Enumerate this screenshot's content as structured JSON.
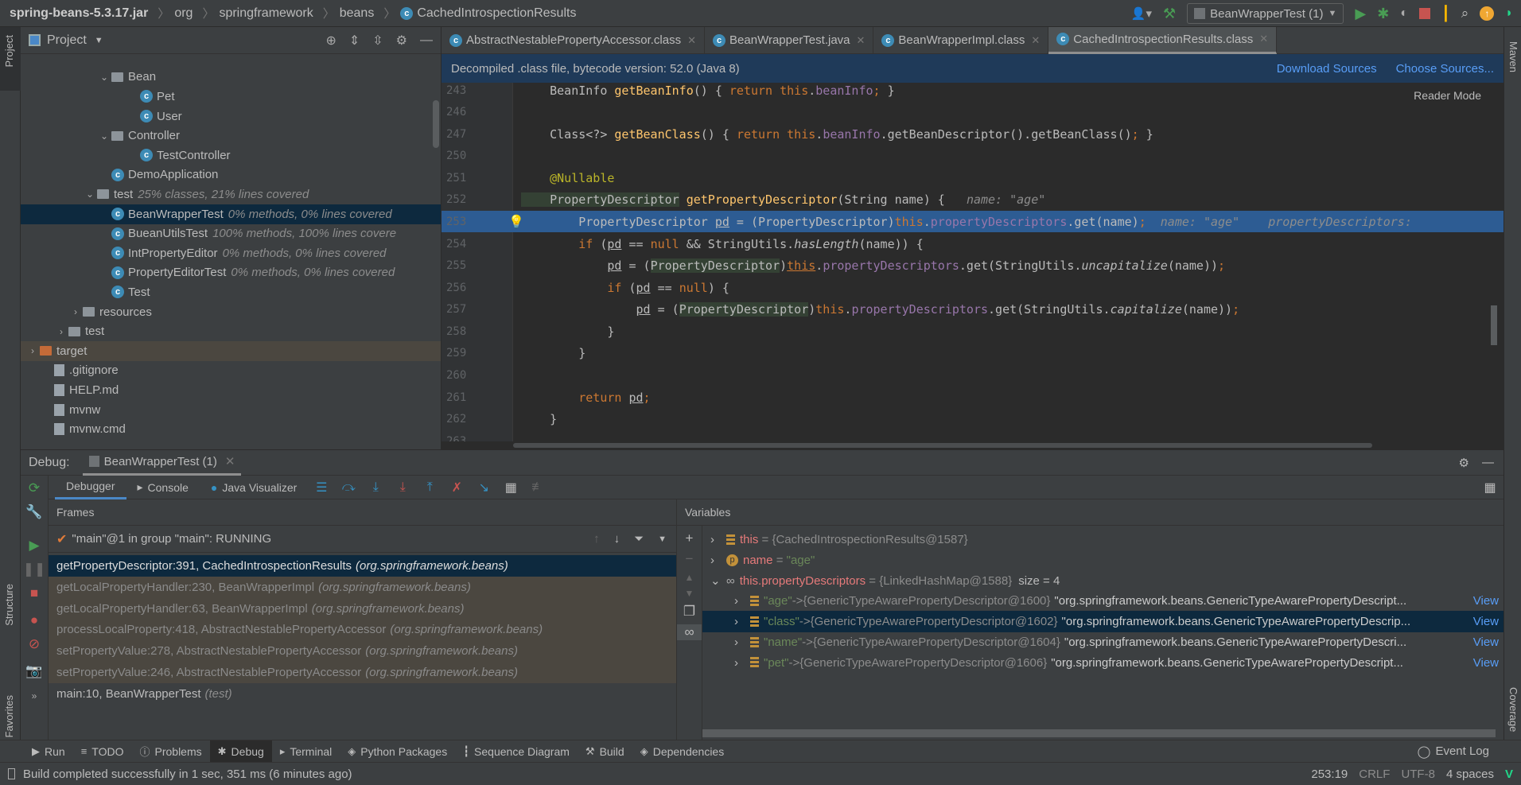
{
  "breadcrumb": [
    "spring-beans-5.3.17.jar",
    "org",
    "springframework",
    "beans",
    "CachedIntrospectionResults"
  ],
  "toolbar": {
    "run_config": "BeanWrapperTest (1)"
  },
  "colors": {
    "accent": "#4a88c7",
    "selection": "#2d5c93",
    "link": "#589df6",
    "run": "#499c54",
    "stop": "#c75450"
  },
  "left_strip": {
    "project": "Project",
    "structure": "Structure",
    "favorites": "Favorites"
  },
  "right_strip": {
    "maven": "Maven",
    "coverage": "Coverage"
  },
  "project": {
    "title": "Project",
    "tree": [
      {
        "label": "Bean",
        "type": "folder",
        "expanded": true,
        "indent": 1
      },
      {
        "label": "Pet",
        "type": "class",
        "indent": 2
      },
      {
        "label": "User",
        "type": "class",
        "indent": 2
      },
      {
        "label": "Controller",
        "type": "folder",
        "expanded": true,
        "indent": 1
      },
      {
        "label": "TestController",
        "type": "class",
        "indent": 2
      },
      {
        "label": "DemoApplication",
        "type": "class",
        "indent": 1
      },
      {
        "label": "test",
        "hint": "25% classes, 21% lines covered",
        "type": "folder",
        "expanded": true,
        "indent": 0.5
      },
      {
        "label": "BeanWrapperTest",
        "hint": "0% methods, 0% lines covered",
        "type": "class",
        "indent": 1,
        "selected": true
      },
      {
        "label": "BueanUtilsTest",
        "hint": "100% methods, 100% lines covere",
        "type": "class",
        "indent": 1
      },
      {
        "label": "IntPropertyEditor",
        "hint": "0% methods, 0% lines covered",
        "type": "class",
        "indent": 1
      },
      {
        "label": "PropertyEditorTest",
        "hint": "0% methods, 0% lines covered",
        "type": "class",
        "indent": 1
      },
      {
        "label": "Test",
        "type": "class",
        "indent": 1
      },
      {
        "label": "resources",
        "type": "folder",
        "expanded": false,
        "indent": 0
      },
      {
        "label": "test",
        "type": "folder",
        "expanded": false,
        "indent": -0.5
      },
      {
        "label": "target",
        "type": "folder-orange",
        "expanded": false,
        "indent": -1.5,
        "highlight": true
      },
      {
        "label": ".gitignore",
        "type": "file",
        "indent": -1
      },
      {
        "label": "HELP.md",
        "type": "file",
        "indent": -1
      },
      {
        "label": "mvnw",
        "type": "file",
        "indent": -1
      },
      {
        "label": "mvnw.cmd",
        "type": "file",
        "indent": -1
      }
    ]
  },
  "editor": {
    "tabs": [
      {
        "label": "AbstractNestablePropertyAccessor.class"
      },
      {
        "label": "BeanWrapperTest.java"
      },
      {
        "label": "BeanWrapperImpl.class"
      },
      {
        "label": "CachedIntrospectionResults.class",
        "active": true
      }
    ],
    "notice": "Decompiled .class file, bytecode version: 52.0 (Java 8)",
    "download_sources": "Download Sources",
    "choose_sources": "Choose Sources...",
    "reader_mode": "Reader Mode",
    "lines": [
      {
        "n": "243",
        "t": [
          [
            "",
            "    BeanInfo "
          ],
          [
            "fn",
            "getBeanInfo"
          ],
          [
            "",
            "() { "
          ],
          [
            "kw",
            "return this"
          ],
          [
            "",
            "."
          ],
          [
            "fld",
            "beanInfo"
          ],
          [
            "kw",
            ";"
          ],
          [
            "",
            " }"
          ]
        ]
      },
      {
        "n": "246",
        "t": []
      },
      {
        "n": "247",
        "t": [
          [
            "",
            "    Class<?> "
          ],
          [
            "fn",
            "getBeanClass"
          ],
          [
            "",
            "() { "
          ],
          [
            "kw",
            "return this"
          ],
          [
            "",
            "."
          ],
          [
            "fld",
            "beanInfo"
          ],
          [
            "",
            ".getBeanDescriptor().getBeanClass()"
          ],
          [
            "kw",
            ";"
          ],
          [
            "",
            " }"
          ]
        ]
      },
      {
        "n": "250",
        "t": []
      },
      {
        "n": "251",
        "t": [
          [
            "ann",
            "    @Nullable"
          ]
        ]
      },
      {
        "n": "252",
        "t": [
          [
            "",
            ""
          ],
          [
            "typ",
            "    PropertyDescriptor"
          ],
          [
            "",
            " "
          ],
          [
            "fn",
            "getPropertyDescriptor"
          ],
          [
            "",
            "(String name) {   "
          ],
          [
            "hint",
            "name: \"age\""
          ]
        ]
      },
      {
        "n": "253",
        "hl": true,
        "t": [
          [
            "",
            "        PropertyDescriptor "
          ],
          [
            "ul",
            "pd"
          ],
          [
            "",
            " = (PropertyDescriptor)"
          ],
          [
            "kw",
            "this"
          ],
          [
            "",
            "."
          ],
          [
            "fld",
            "propertyDescriptors"
          ],
          [
            "",
            ".get(name)"
          ],
          [
            "kw",
            ";"
          ],
          [
            "",
            "  "
          ],
          [
            "hint",
            "name: \"age\"    propertyDescriptors: "
          ]
        ]
      },
      {
        "n": "254",
        "t": [
          [
            "kw",
            "        if"
          ],
          [
            "",
            " ("
          ],
          [
            "ul",
            "pd"
          ],
          [
            "",
            " == "
          ],
          [
            "kw",
            "null"
          ],
          [
            "",
            " && StringUtils."
          ],
          [
            "it",
            "hasLength"
          ],
          [
            "",
            "(name)) {"
          ]
        ]
      },
      {
        "n": "255",
        "t": [
          [
            "",
            "            "
          ],
          [
            "ul",
            "pd"
          ],
          [
            "",
            " = ("
          ],
          [
            "typ",
            "PropertyDescriptor"
          ],
          [
            "",
            ")"
          ],
          [
            "kw ul",
            "this"
          ],
          [
            "",
            "."
          ],
          [
            "fld",
            "propertyDescriptors"
          ],
          [
            "",
            ".get(StringUtils."
          ],
          [
            "it",
            "uncapitalize"
          ],
          [
            "",
            "(name))"
          ],
          [
            "kw",
            ";"
          ]
        ]
      },
      {
        "n": "256",
        "t": [
          [
            "kw",
            "            if"
          ],
          [
            "",
            " ("
          ],
          [
            "ul",
            "pd"
          ],
          [
            "",
            " == "
          ],
          [
            "kw",
            "null"
          ],
          [
            "",
            ") {"
          ]
        ]
      },
      {
        "n": "257",
        "t": [
          [
            "",
            "                "
          ],
          [
            "ul",
            "pd"
          ],
          [
            "",
            " = ("
          ],
          [
            "typ",
            "PropertyDescriptor"
          ],
          [
            "",
            ")"
          ],
          [
            "kw",
            "this"
          ],
          [
            "",
            "."
          ],
          [
            "fld",
            "propertyDescriptors"
          ],
          [
            "",
            ".get(StringUtils."
          ],
          [
            "it",
            "capitalize"
          ],
          [
            "",
            "(name))"
          ],
          [
            "kw",
            ";"
          ]
        ]
      },
      {
        "n": "258",
        "t": [
          [
            "",
            "            }"
          ]
        ]
      },
      {
        "n": "259",
        "t": [
          [
            "",
            "        }"
          ]
        ]
      },
      {
        "n": "260",
        "t": []
      },
      {
        "n": "261",
        "t": [
          [
            "kw",
            "        return "
          ],
          [
            "ul",
            "pd"
          ],
          [
            "kw",
            ";"
          ]
        ]
      },
      {
        "n": "262",
        "t": [
          [
            "",
            "    }"
          ]
        ]
      },
      {
        "n": "263",
        "t": []
      }
    ]
  },
  "debug": {
    "label": "Debug:",
    "session": "BeanWrapperTest (1)",
    "tabs": [
      "Debugger",
      "Console",
      "Java Visualizer"
    ],
    "frames_title": "Frames",
    "variables_title": "Variables",
    "thread": "\"main\"@1 in group \"main\": RUNNING",
    "frames": [
      {
        "method": "getPropertyDescriptor:391, CachedIntrospectionResults",
        "pkg": "(org.springframework.beans)",
        "state": "selected"
      },
      {
        "method": "getLocalPropertyHandler:230, BeanWrapperImpl",
        "pkg": "(org.springframework.beans)",
        "state": "library"
      },
      {
        "method": "getLocalPropertyHandler:63, BeanWrapperImpl",
        "pkg": "(org.springframework.beans)",
        "state": "library"
      },
      {
        "method": "processLocalProperty:418, AbstractNestablePropertyAccessor",
        "pkg": "(org.springframework.beans)",
        "state": "library"
      },
      {
        "method": "setPropertyValue:278, AbstractNestablePropertyAccessor",
        "pkg": "(org.springframework.beans)",
        "state": "library"
      },
      {
        "method": "setPropertyValue:246, AbstractNestablePropertyAccessor",
        "pkg": "(org.springframework.beans)",
        "state": "library"
      },
      {
        "method": "main:10, BeanWrapperTest",
        "pkg": "(test)",
        "state": "normal"
      }
    ],
    "variables": [
      {
        "name": "this",
        "eq": " = ",
        "value": "{CachedIntrospectionResults@1587}",
        "icon": "field",
        "expanded": false
      },
      {
        "name": "name",
        "eq": " = ",
        "value": "\"age\"",
        "icon": "param",
        "expanded": false
      },
      {
        "name": "this.propertyDescriptors",
        "eq": " = ",
        "value": "{LinkedHashMap@1588}",
        "extra": "size = 4",
        "icon": "watch",
        "expanded": true
      },
      {
        "key": "\"age\"",
        "arrow": " -> ",
        "value": "{GenericTypeAwarePropertyDescriptor@1600}",
        "str": "\"org.springframework.beans.GenericTypeAwarePropertyDescript...",
        "view": "View",
        "child": true
      },
      {
        "key": "\"class\"",
        "arrow": " -> ",
        "value": "{GenericTypeAwarePropertyDescriptor@1602}",
        "str": "\"org.springframework.beans.GenericTypeAwarePropertyDescrip...",
        "view": "View",
        "child": true,
        "selected": true
      },
      {
        "key": "\"name\"",
        "arrow": " -> ",
        "value": "{GenericTypeAwarePropertyDescriptor@1604}",
        "str": "\"org.springframework.beans.GenericTypeAwarePropertyDescri...",
        "view": "View",
        "child": true
      },
      {
        "key": "\"pet\"",
        "arrow": " -> ",
        "value": "{GenericTypeAwarePropertyDescriptor@1606}",
        "str": "\"org.springframework.beans.GenericTypeAwarePropertyDescript...",
        "view": "View",
        "child": true
      }
    ]
  },
  "bottom_tabs": [
    {
      "label": "Run",
      "icon": "run-icon"
    },
    {
      "label": "TODO",
      "icon": "list-icon"
    },
    {
      "label": "Problems",
      "icon": "problems-icon"
    },
    {
      "label": "Debug",
      "icon": "bug-icon",
      "active": true
    },
    {
      "label": "Terminal",
      "icon": "terminal-icon"
    },
    {
      "label": "Python Packages",
      "icon": "packages-icon"
    },
    {
      "label": "Sequence Diagram",
      "icon": "sequence-icon"
    },
    {
      "label": "Build",
      "icon": "hammer-icon"
    },
    {
      "label": "Dependencies",
      "icon": "dependencies-icon"
    }
  ],
  "event_log": "Event Log",
  "status": {
    "message": "Build completed successfully in 1 sec, 351 ms (6 minutes ago)",
    "position": "253:19",
    "line_sep": "CRLF",
    "encoding": "UTF-8",
    "indent": "4 spaces"
  }
}
